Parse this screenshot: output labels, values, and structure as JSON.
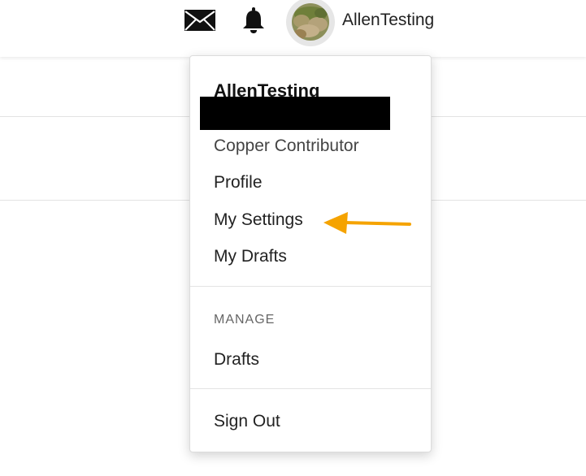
{
  "header": {
    "username": "AllenTesting",
    "icons": [
      "mail-icon",
      "bell-icon"
    ]
  },
  "menu": {
    "name": "AllenTesting",
    "rank": "Copper Contributor",
    "items": [
      {
        "label": "Profile"
      },
      {
        "label": "My Settings"
      },
      {
        "label": "My Drafts"
      }
    ],
    "manage": {
      "label": "MANAGE",
      "items": [
        {
          "label": "Drafts"
        }
      ]
    },
    "sign_out": "Sign Out"
  },
  "colors": {
    "annotation_arrow": "#f5a300",
    "redaction": "#000000"
  }
}
